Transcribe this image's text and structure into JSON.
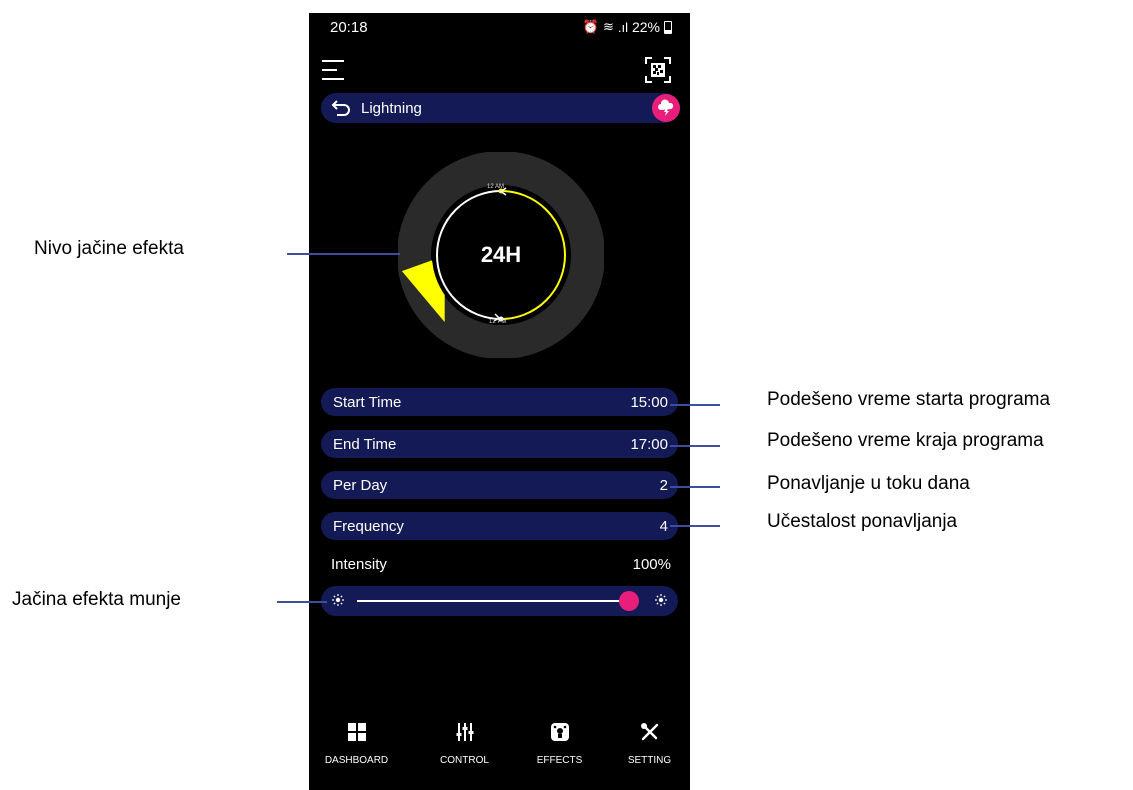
{
  "status_bar": {
    "time": "20:18",
    "battery": "22%"
  },
  "header": {
    "menu_icon": "hamburger-menu-icon",
    "qr_icon": "qr-code-icon"
  },
  "effect_bar": {
    "title": "Lightning",
    "back_icon": "back-arrow-icon",
    "cloud_icon": "lightning-cloud-icon"
  },
  "dial": {
    "label": "24H",
    "top_tick": "12 AM",
    "bottom_tick": "12 PM",
    "accent_color": "#ffff00",
    "ring_color": "#2a2a2a"
  },
  "settings": {
    "start_time": {
      "label": "Start Time",
      "value": "15:00"
    },
    "end_time": {
      "label": "End Time",
      "value": "17:00"
    },
    "per_day": {
      "label": "Per Day",
      "value": "2"
    },
    "frequency": {
      "label": "Frequency",
      "value": "4"
    }
  },
  "intensity": {
    "label": "Intensity",
    "value": "100%",
    "level": 0.98
  },
  "bottom_nav": {
    "dashboard": "DASHBOARD",
    "control": "CONTROL",
    "effects": "EFFECTS",
    "setting": "SETTING"
  },
  "annotations": {
    "effect_level": "Nivo jačine efekta",
    "start_time": "Podešeno vreme starta programa",
    "end_time": "Podešeno vreme kraja programa",
    "repeat_per_day": "Ponavljanje u toku dana",
    "repeat_frequency": "Učestalost ponavljanja",
    "lightning_strength": "Jačina efekta munje"
  },
  "colors": {
    "row_bg": "#141a55",
    "accent_pink": "#e91e7b",
    "callout_line": "#3d4ea0"
  }
}
